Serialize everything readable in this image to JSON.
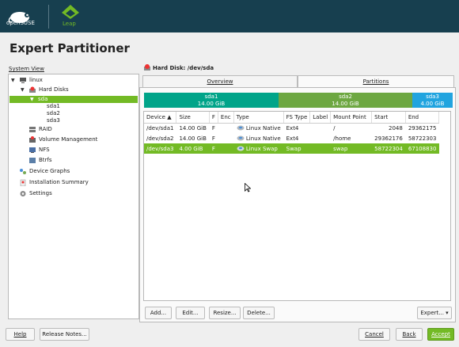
{
  "header": {
    "brand": "openSUSE",
    "product": "Leap"
  },
  "page_title": "Expert Partitioner",
  "system_view_label": "System View",
  "tree": {
    "root": "linux",
    "hard_disks": "Hard Disks",
    "sda": "sda",
    "sda1": "sda1",
    "sda2": "sda2",
    "sda3": "sda3",
    "raid": "RAID",
    "volume_management": "Volume Management",
    "nfs": "NFS",
    "btrfs": "Btrfs",
    "device_graphs": "Device Graphs",
    "installation_summary": "Installation Summary",
    "settings": "Settings"
  },
  "disk_title": "Hard Disk: /dev/sda",
  "tabs": {
    "overview": "Overview",
    "partitions": "Partitions"
  },
  "segments": [
    {
      "name": "sda1",
      "size": "14.00 GiB",
      "color": "#00a489"
    },
    {
      "name": "sda2",
      "size": "14.00 GiB",
      "color": "#6da741"
    },
    {
      "name": "sda3",
      "size": "4.00 GiB",
      "color": "#21a4df"
    }
  ],
  "table": {
    "headers": [
      "Device",
      "Size",
      "F",
      "Enc",
      "Type",
      "FS Type",
      "Label",
      "Mount Point",
      "Start",
      "End"
    ],
    "rows": [
      {
        "device": "/dev/sda1",
        "size": "14.00 GiB",
        "f": "F",
        "enc": "",
        "type": "Linux Native",
        "fs": "Ext4",
        "label": "",
        "mount": "/",
        "start": "2048",
        "end": "29362175"
      },
      {
        "device": "/dev/sda2",
        "size": "14.00 GiB",
        "f": "F",
        "enc": "",
        "type": "Linux Native",
        "fs": "Ext4",
        "label": "",
        "mount": "/home",
        "start": "29362176",
        "end": "58722303"
      },
      {
        "device": "/dev/sda3",
        "size": "4.00 GiB",
        "f": "F",
        "enc": "",
        "type": "Linux Swap",
        "fs": "Swap",
        "label": "",
        "mount": "swap",
        "start": "58722304",
        "end": "67108830"
      }
    ]
  },
  "buttons": {
    "add": "Add...",
    "edit": "Edit...",
    "resize": "Resize...",
    "delete": "Delete...",
    "expert": "Expert...",
    "help": "Help",
    "release_notes": "Release Notes...",
    "cancel": "Cancel",
    "back": "Back",
    "accept": "Accept"
  },
  "colors": {
    "topbar": "#173f4f",
    "accent": "#73ba25"
  }
}
